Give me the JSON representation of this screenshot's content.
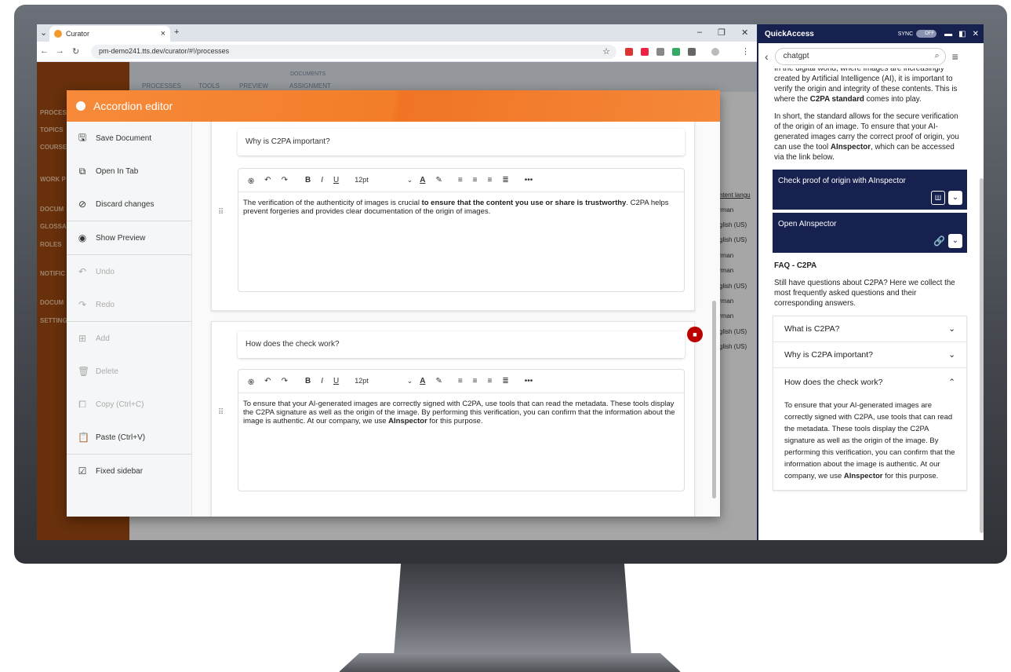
{
  "browser": {
    "tab_title": "Curator",
    "url": "pm-demo241.tts.dev/curator/#!/processes",
    "new_tab": "+",
    "close_tab": "×",
    "minimize": "–",
    "restore": "❐",
    "close": "✕"
  },
  "app_bg": {
    "nav": [
      "PROCESS",
      "TOPICS",
      "COURSE",
      "WORK P",
      "DOCUM",
      "GLOSSA",
      "ROLES",
      "NOTIFIC",
      "DOCUM",
      "SETTING"
    ],
    "top_tabs": [
      "PROCESSES",
      "TOOLS",
      "PREVIEW",
      "ASSIGNMENT"
    ],
    "top_label": "DOCUMENTS",
    "lang_header": "ntent langu",
    "langs": [
      "rman",
      "glish (US)",
      "glish (US)",
      "rman",
      "rman",
      "glish (US)",
      "rman",
      "rman",
      "glish (US)",
      "glish (US)"
    ]
  },
  "editor": {
    "title": "Accordion editor",
    "sidebar": [
      {
        "label": "Save Document",
        "icon": "🖫",
        "enabled": true
      },
      {
        "label": "Open In Tab",
        "icon": "⧉",
        "enabled": true
      },
      {
        "label": "Discard changes",
        "icon": "⊘",
        "enabled": true
      },
      {
        "label": "Show Preview",
        "icon": "◉",
        "enabled": true
      },
      {
        "label": "Undo",
        "icon": "↶",
        "enabled": false
      },
      {
        "label": "Redo",
        "icon": "↷",
        "enabled": false
      },
      {
        "label": "Add",
        "icon": "⊞",
        "enabled": false
      },
      {
        "label": "Delete",
        "icon": "🗑",
        "enabled": false
      },
      {
        "label": "Copy (Ctrl+C)",
        "icon": "⧠",
        "enabled": false
      },
      {
        "label": "Paste (Ctrl+V)",
        "icon": "📋",
        "enabled": true
      },
      {
        "label": "Fixed sidebar",
        "icon": "☑",
        "enabled": true
      }
    ],
    "toolbar": {
      "ai": "֍",
      "undo": "↶",
      "redo": "↷",
      "bold": "B",
      "italic": "I",
      "underline": "U",
      "size": "12pt",
      "dd": "⌄",
      "font_color": "A",
      "highlight": "✎",
      "align_left": "≡",
      "align_center": "≡",
      "align_right": "≡",
      "justify": "≣",
      "more": "•••"
    },
    "items": [
      {
        "question": "Why is C2PA important?",
        "answer_pre": "The verification of the authenticity of images is crucial ",
        "answer_bold": "to ensure that the content you use or share is trustworthy",
        "answer_post": ". C2PA helps prevent forgeries and provides clear documentation of the origin of images."
      },
      {
        "question": "How does the check work?",
        "answer_pre": "To ensure that your AI-generated images are correctly signed with C2PA, use tools that can read the metadata. These tools display the C2PA signature as well as the origin of the image. By performing this verification, you can confirm that the information about the image is authentic. At our company, we use ",
        "answer_bold": "AInspector",
        "answer_post": " for this purpose."
      }
    ]
  },
  "quickaccess": {
    "title": "QuickAccess",
    "sync": "SYNC",
    "toggle": "OFF",
    "search": "chatgpt",
    "intro_pre": "In the digital world, where images are increasingly created by Artificial Intelligence (AI), it is important to verify the origin and integrity of these contents. This is where the ",
    "intro_bold": "C2PA standard",
    "intro_post": " comes into play.",
    "p2_pre": "In short, the standard allows for the secure verification of the origin of an image. To ensure that your AI-generated images carry the correct proof of origin, you can use the tool ",
    "p2_bold": "AInspector",
    "p2_post": ", which can be accessed via the link below.",
    "btn1": "Check proof of origin with AInspector",
    "btn2": "Open AInspector",
    "faq_title": "FAQ - C2PA",
    "faq_intro": "Still have questions about C2PA? Here we collect the most frequently asked questions and their corresponding answers.",
    "faq": [
      {
        "q": "What is C2PA?",
        "open": false
      },
      {
        "q": "Why is C2PA important?",
        "open": false
      },
      {
        "q": "How does the check work?",
        "open": true
      }
    ],
    "faq_answer_pre": "To ensure that your AI-generated images are correctly signed with C2PA, use tools that can read the metadata. These tools display the C2PA signature as well as the origin of the image. By performing this verification, you can confirm that the information about the image is authentic. At our company, we use ",
    "faq_answer_bold": "AInspector",
    "faq_answer_post": " for this purpose."
  }
}
